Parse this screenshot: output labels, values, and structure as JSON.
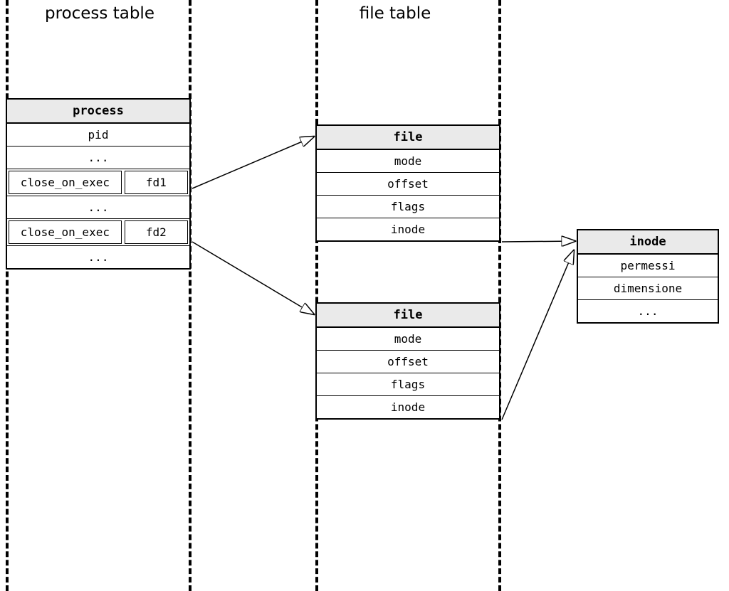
{
  "sections": {
    "process_table": "process table",
    "file_table": "file table"
  },
  "process": {
    "title": "process",
    "rows": {
      "pid": "pid",
      "dots1": "...",
      "coe1": "close_on_exec",
      "fd1": "fd1",
      "dots2": "...",
      "coe2": "close_on_exec",
      "fd2": "fd2",
      "dots3": "..."
    }
  },
  "file1": {
    "title": "file",
    "mode": "mode",
    "offset": "offset",
    "flags": "flags",
    "inode": "inode"
  },
  "file2": {
    "title": "file",
    "mode": "mode",
    "offset": "offset",
    "flags": "flags",
    "inode": "inode"
  },
  "inode": {
    "title": "inode",
    "perms": "permessi",
    "size": "dimensione",
    "dots": "..."
  }
}
